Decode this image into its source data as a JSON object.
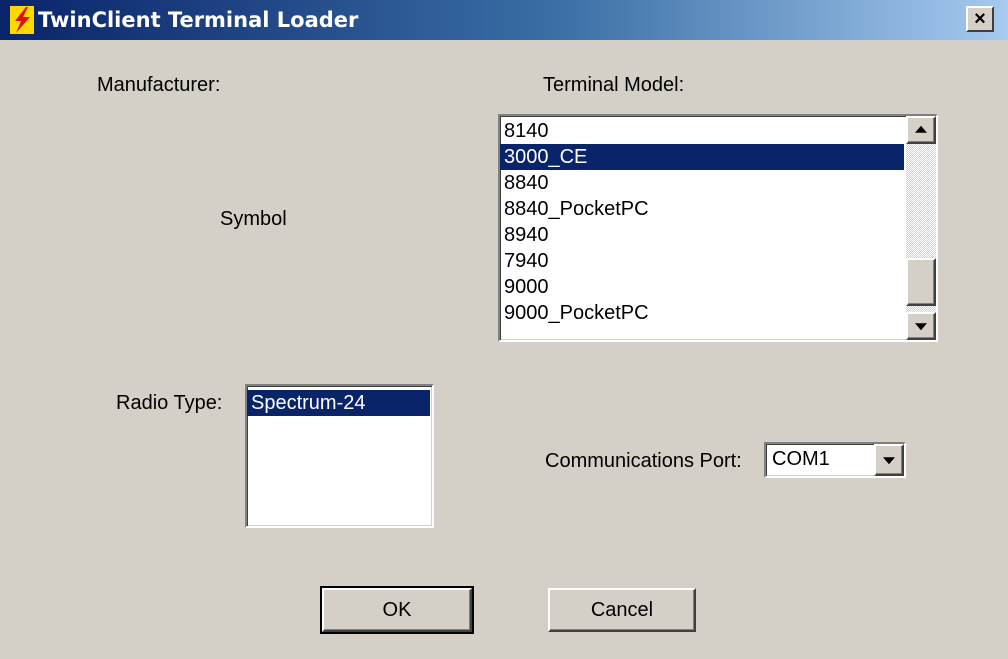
{
  "window": {
    "title": "TwinClient Terminal Loader",
    "close_label": "×"
  },
  "manufacturer": {
    "label": "Manufacturer:",
    "value": "Symbol"
  },
  "terminal_model": {
    "label": "Terminal Model:",
    "items": [
      "8140",
      "3000_CE",
      "8840",
      "8840_PocketPC",
      "8940",
      "7940",
      "9000",
      "9000_PocketPC"
    ],
    "selected_index": 1
  },
  "radio_type": {
    "label": "Radio Type:",
    "items": [
      "Spectrum-24"
    ],
    "selected_index": 0
  },
  "comm_port": {
    "label": "Communications Port:",
    "value": "COM1"
  },
  "buttons": {
    "ok": "OK",
    "cancel": "Cancel"
  },
  "colors": {
    "face": "#d4d0c8",
    "selection": "#0a246a",
    "title_start": "#0a246a",
    "title_end": "#a6caf0",
    "icon_bolt": "#e01010",
    "icon_bg": "#ffd800"
  },
  "icons": {
    "app": "lightning-bolt-icon",
    "close": "close-icon",
    "scroll_up": "arrow-up-icon",
    "scroll_down": "arrow-down-icon",
    "dropdown": "arrow-down-icon"
  }
}
